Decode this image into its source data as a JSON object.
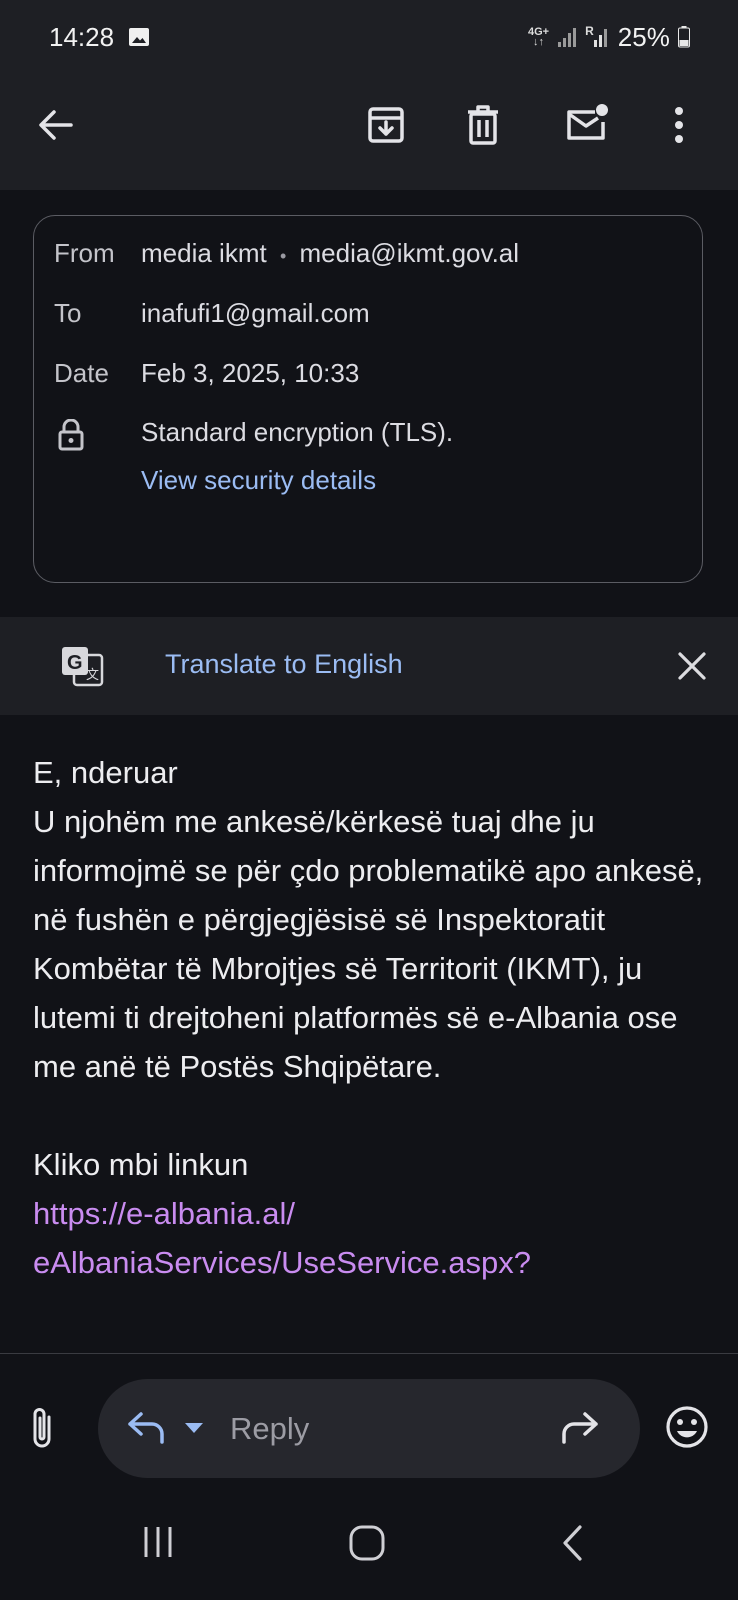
{
  "status_bar": {
    "time": "14:28",
    "network_label": "4G+",
    "roaming_label": "R",
    "battery": "25%"
  },
  "app_bar": {
    "icons": [
      "back-arrow-icon",
      "archive-icon",
      "delete-icon",
      "mark-unread-icon",
      "more-vert-icon"
    ]
  },
  "details": {
    "from_label": "From",
    "from_name": "media ikmt",
    "from_email": "media@ikmt.gov.al",
    "to_label": "To",
    "to_value": "inafufi1@gmail.com",
    "date_label": "Date",
    "date_value": "Feb 3, 2025, 10:33",
    "encryption": "Standard encryption (TLS).",
    "security_link": "View security details"
  },
  "translate": {
    "label": "Translate to English"
  },
  "email_body": {
    "greeting": "E, nderuar",
    "paragraph": "U njohëm me ankesë/kërkesë tuaj dhe ju informojmë se për çdo problematikë apo ankesë, në fushën e përgjegjësisë së Inspektoratit Kombëtar të Mbrojtjes së Territorit (IKMT), ju lutemi ti drejtoheni platformës së e-Albania ose me anë të Postës Shqipëtare.",
    "cta": "Kliko mbi linkun",
    "link_line1": "https://e-albania.al/",
    "link_line2": "eAlbaniaServices/UseService.aspx?"
  },
  "reply_bar": {
    "placeholder": "Reply"
  },
  "colors": {
    "background": "#111217",
    "surface": "#1e1f24",
    "link_blue": "#9bbcf3",
    "link_purple": "#c98cf0"
  }
}
